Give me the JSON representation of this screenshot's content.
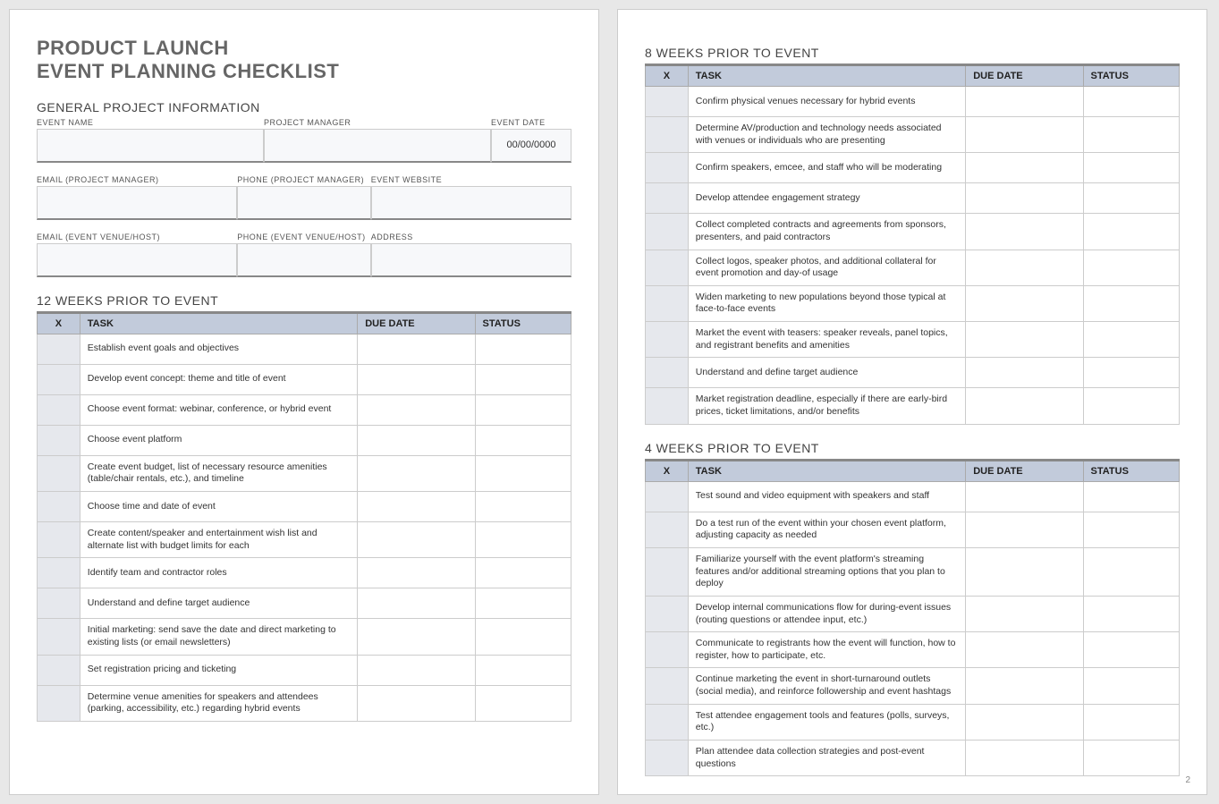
{
  "title_line1": "PRODUCT LAUNCH",
  "title_line2": "EVENT PLANNING CHECKLIST",
  "general_info_heading": "GENERAL PROJECT INFORMATION",
  "fields": {
    "event_name_label": "EVENT NAME",
    "project_manager_label": "PROJECT MANAGER",
    "event_date_label": "EVENT DATE",
    "event_date_value": "00/00/0000",
    "email_pm_label": "EMAIL (PROJECT MANAGER)",
    "phone_pm_label": "PHONE (PROJECT MANAGER)",
    "event_website_label": "EVENT WEBSITE",
    "email_venue_label": "EMAIL (EVENT VENUE/HOST)",
    "phone_venue_label": "PHONE (EVENT VENUE/HOST)",
    "address_label": "ADDRESS"
  },
  "table_headers": {
    "x": "X",
    "task": "TASK",
    "due": "DUE DATE",
    "status": "STATUS"
  },
  "sections": {
    "w12": {
      "title": "12 WEEKS PRIOR TO EVENT",
      "tasks": [
        "Establish event goals and objectives",
        "Develop event concept: theme and title of event",
        "Choose event format: webinar, conference, or hybrid event",
        "Choose event platform",
        "Create event budget, list of necessary resource amenities (table/chair rentals, etc.), and timeline",
        "Choose time and date of event",
        "Create content/speaker and entertainment wish list and alternate list with budget limits for each",
        "Identify team and contractor roles",
        "Understand and define target audience",
        "Initial marketing: send save the date and direct marketing to existing lists (or email newsletters)",
        "Set registration pricing and ticketing",
        "Determine venue amenities for speakers and attendees (parking, accessibility, etc.) regarding hybrid events"
      ]
    },
    "w8": {
      "title": "8 WEEKS PRIOR TO EVENT",
      "tasks": [
        "Confirm physical venues necessary for hybrid events",
        "Determine AV/production and technology needs associated with venues or individuals who are presenting",
        "Confirm speakers, emcee, and staff who will be moderating",
        "Develop attendee engagement strategy",
        "Collect completed contracts and agreements from sponsors, presenters, and paid contractors",
        "Collect logos, speaker photos, and additional collateral for event promotion and day-of usage",
        "Widen marketing to new populations beyond those typical at face-to-face events",
        "Market the event with teasers: speaker reveals, panel topics, and registrant benefits and amenities",
        "Understand and define target audience",
        "Market registration deadline, especially if there are early-bird prices, ticket limitations, and/or benefits"
      ]
    },
    "w4": {
      "title": "4 WEEKS PRIOR TO EVENT",
      "tasks": [
        "Test sound and video equipment with speakers and staff",
        "Do a test run of the event within your chosen event platform, adjusting capacity as needed",
        "Familiarize yourself with the event platform's streaming features and/or additional streaming options that you plan to deploy",
        "Develop internal communications flow for during-event issues (routing questions or attendee input, etc.)",
        "Communicate to registrants how the event will function, how to register, how to participate, etc.",
        "Continue marketing the event in short-turnaround outlets (social media), and reinforce followership and event hashtags",
        "Test attendee engagement tools and features (polls, surveys, etc.)",
        "Plan attendee data collection strategies and post-event questions"
      ]
    }
  },
  "page_number": "2"
}
